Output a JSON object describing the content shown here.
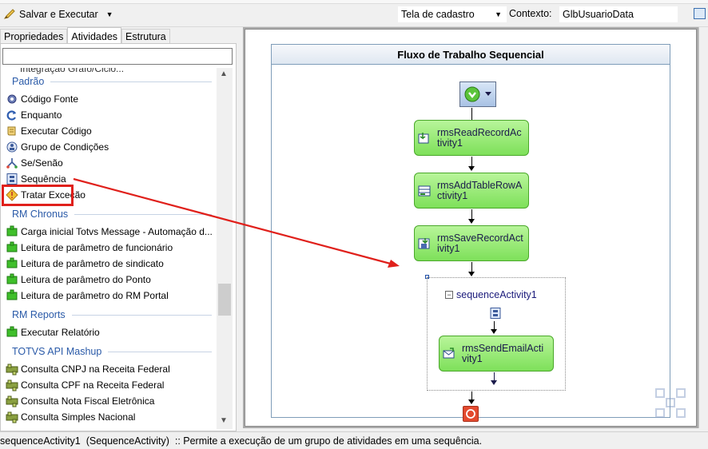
{
  "toolbar": {
    "save_label": "Salvar e Executar",
    "form_select_value": "Tela de cadastro",
    "context_label": "Contexto:",
    "context_value": "GlbUsuarioData"
  },
  "tabs": [
    {
      "label": "Propriedades"
    },
    {
      "label": "Atividades"
    },
    {
      "label": "Estrutura"
    }
  ],
  "toolbox": {
    "cut_item": "Integração Grafo/Ciclo...",
    "groups": {
      "padrao": "Padrão",
      "chronus": "RM Chronus",
      "reports": "RM Reports",
      "mashup": "TOTVS API Mashup"
    },
    "padrao_items": [
      "Código Fonte",
      "Enquanto",
      "Executar Código",
      "Grupo de Condições",
      "Se/Senão",
      "Sequência",
      "Tratar Exceção"
    ],
    "chronus_items": [
      "Carga inicial Totvs Message - Automação d...",
      "Leitura de parâmetro de funcionário",
      "Leitura de parâmetro de sindicato",
      "Leitura de parâmetro do Ponto",
      "Leitura de parâmetro do RM Portal"
    ],
    "reports_items": [
      "Executar Relatório"
    ],
    "mashup_items": [
      "Consulta CNPJ na Receita Federal",
      "Consulta CPF na Receita Federal",
      "Consulta Nota Fiscal Eletrônica",
      "Consulta Simples Nacional"
    ]
  },
  "workflow": {
    "title": "Fluxo de Trabalho Sequencial",
    "activities": [
      "rmsReadRecordAc\ntivity1",
      "rmsAddTableRowA\nctivity1",
      "rmsSaveRecordAct\nivity1",
      "rmsSendEmailActi\nvity1"
    ],
    "sequence_label": "sequenceActivity1"
  },
  "status": {
    "text": "sequenceActivity1  (SequenceActivity)  :: Permite a execução de um grupo de atividades em uma sequência."
  },
  "colors": {
    "accent_red": "#e0201b",
    "activity_green": "#7ee05a",
    "group_blue": "#2a5aa8"
  }
}
